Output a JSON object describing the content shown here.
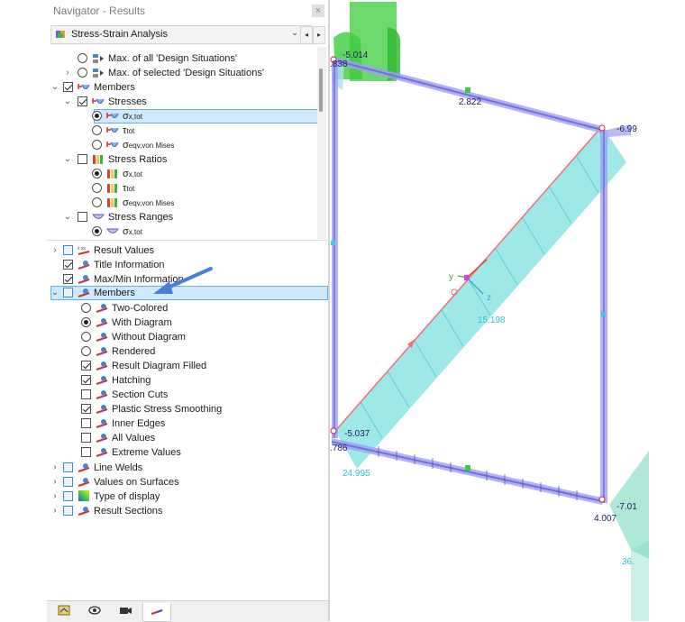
{
  "navigator": {
    "title": "Navigator - Results",
    "close_label": "×",
    "combo": {
      "value": "Stress-Strain Analysis",
      "dropdown": "⌄"
    },
    "prev_label": "◂",
    "next_label": "▸"
  },
  "top_tree": {
    "max_all": "Max. of all 'Design Situations'",
    "max_selected": "Max. of selected 'Design Situations'",
    "members": "Members",
    "stresses": "Stresses",
    "sigma_main": "σ",
    "sigma_sub": "x,tot",
    "tau_main": "τ",
    "tau_sub": "tot",
    "seqv_main": "σ",
    "seqv_sub": "eqv,von Mises",
    "stress_ratios": "Stress Ratios",
    "stress_ranges": "Stress Ranges"
  },
  "bottom_tree": {
    "result_values": "Result Values",
    "title_information": "Title Information",
    "max_min_information": "Max/Min Information",
    "members": "Members",
    "two_colored": "Two-Colored",
    "with_diagram": "With Diagram",
    "without_diagram": "Without Diagram",
    "rendered": "Rendered",
    "result_diagram_filled": "Result Diagram Filled",
    "hatching": "Hatching",
    "section_cuts": "Section Cuts",
    "plastic_stress_smoothing": "Plastic Stress Smoothing",
    "inner_edges": "Inner Edges",
    "all_values": "All Values",
    "extreme_values": "Extreme Values",
    "line_welds": "Line Welds",
    "values_on_surfaces": "Values on Surfaces",
    "type_of_display": "Type of display",
    "result_sections": "Result Sections"
  },
  "viewport": {
    "labels": {
      "top_left_value": "-5.014",
      "top_left_cut": ".838",
      "top_mid": "2.822",
      "top_right": "-6.99",
      "axis_y": "y",
      "axis_z": "z",
      "diag_mid": "15.198",
      "bottom_left_value": "-5.037",
      "bottom_left_cut": ".786",
      "bottom_left_below": "24.995",
      "bottom_right": "-7.01",
      "bottom_right_below": "4.007",
      "far_right_bottom": "36."
    }
  },
  "colors": {
    "member_blue": "#6f6fe0",
    "diagram_cyan": "#7de0e0",
    "highlight_blue": "#cde8ff",
    "arrow_blue": "#4a7fd8",
    "support_green": "#3ccc3c"
  }
}
